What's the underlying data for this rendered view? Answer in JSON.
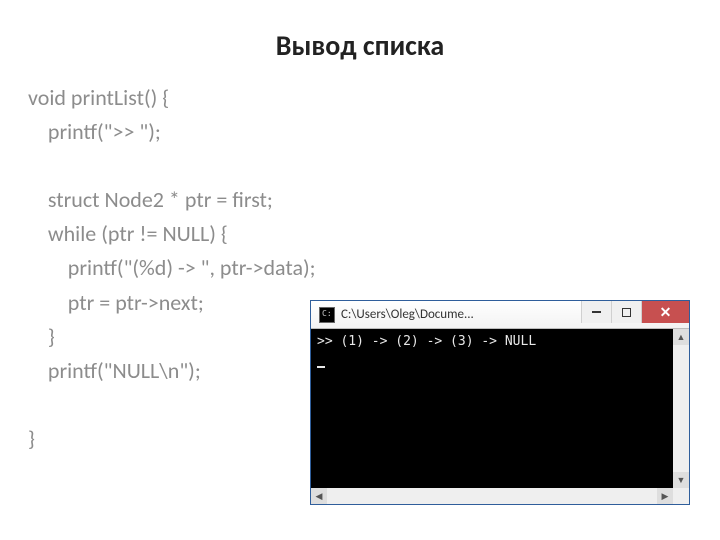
{
  "title": "Вывод списка",
  "code": {
    "l1": "void printList() {",
    "l2": "    printf(\">> \");",
    "l3": "",
    "l4": "    struct Node2 * ptr = first;",
    "l5": "    while (ptr != NULL) {",
    "l6": "        printf(\"(%d) -> \", ptr->data);",
    "l7": "        ptr = ptr->next;",
    "l8": "    }",
    "l9": "    printf(\"NULL\\n\");",
    "l10": "",
    "l11": "}"
  },
  "console": {
    "title": "C:\\Users\\Oleg\\Docume...",
    "output": ">> (1) -> (2) -> (3) -> NULL"
  }
}
